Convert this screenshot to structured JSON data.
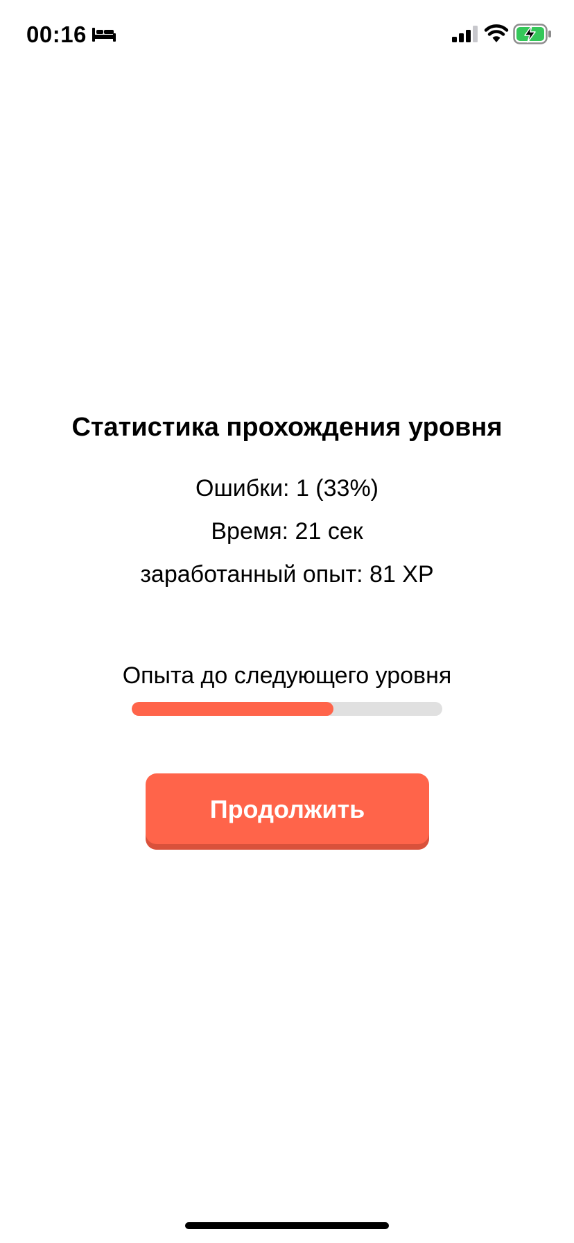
{
  "status_bar": {
    "time": "00:16",
    "icons": [
      "bed-icon",
      "cellular-signal-icon",
      "wifi-icon",
      "battery-charging-icon"
    ]
  },
  "stats": {
    "title": "Статистика прохождения уровня",
    "errors": "Ошибки: 1 (33%)",
    "time": "Время: 21 сек",
    "xp_earned": "заработанный опыт: 81 XP"
  },
  "progress": {
    "label": "Опыта до следующего уровня",
    "fraction": 0.65
  },
  "continue_button": {
    "label": "Продолжить"
  },
  "colors": {
    "accent": "#ff644a",
    "accent_shadow": "#d9513b",
    "track": "#e0e0e0",
    "battery_green": "#34c759"
  }
}
